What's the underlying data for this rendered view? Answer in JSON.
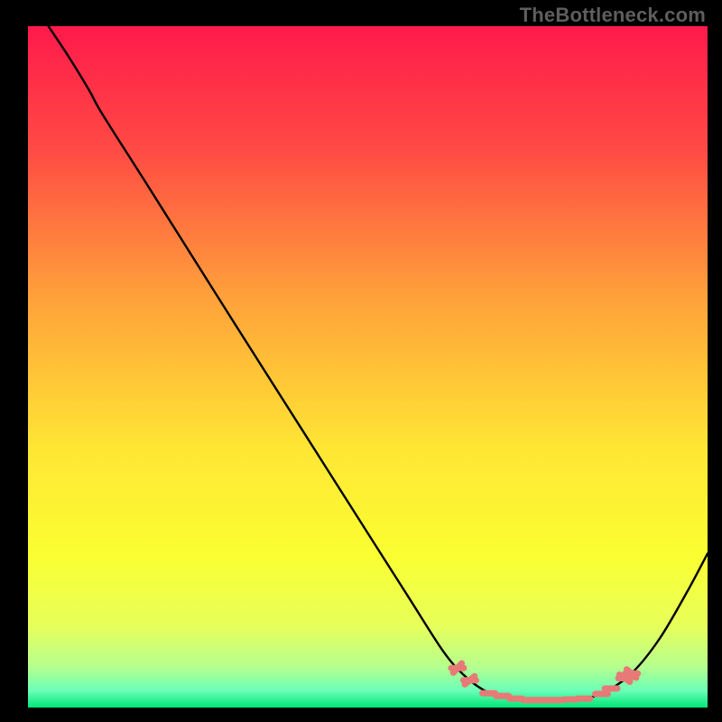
{
  "watermark": "TheBottleneck.com",
  "chart_data": {
    "type": "line",
    "title": "",
    "xlabel": "",
    "ylabel": "",
    "xlim": [
      0,
      100
    ],
    "ylim": [
      0,
      100
    ],
    "background_gradient": {
      "stops": [
        {
          "offset": 0.0,
          "color": "#ff1a4b"
        },
        {
          "offset": 0.18,
          "color": "#ff4a44"
        },
        {
          "offset": 0.4,
          "color": "#ffa23a"
        },
        {
          "offset": 0.62,
          "color": "#ffe634"
        },
        {
          "offset": 0.78,
          "color": "#faff32"
        },
        {
          "offset": 0.88,
          "color": "#e7ff5a"
        },
        {
          "offset": 0.94,
          "color": "#b6ff8e"
        },
        {
          "offset": 0.975,
          "color": "#6cffb8"
        },
        {
          "offset": 1.0,
          "color": "#00e676"
        }
      ]
    },
    "series": [
      {
        "name": "bottleneck-curve",
        "color": "#000000",
        "points": [
          {
            "x": 3.0,
            "y": 100.0
          },
          {
            "x": 6.0,
            "y": 95.5
          },
          {
            "x": 9.0,
            "y": 90.6
          },
          {
            "x": 11.0,
            "y": 87.0
          },
          {
            "x": 18.0,
            "y": 76.0
          },
          {
            "x": 30.0,
            "y": 57.0
          },
          {
            "x": 40.0,
            "y": 41.3
          },
          {
            "x": 50.0,
            "y": 25.6
          },
          {
            "x": 56.0,
            "y": 16.2
          },
          {
            "x": 61.0,
            "y": 8.4
          },
          {
            "x": 64.0,
            "y": 4.9
          },
          {
            "x": 67.0,
            "y": 2.6
          },
          {
            "x": 70.0,
            "y": 1.5
          },
          {
            "x": 74.0,
            "y": 1.1
          },
          {
            "x": 78.0,
            "y": 1.1
          },
          {
            "x": 82.0,
            "y": 1.4
          },
          {
            "x": 85.0,
            "y": 2.3
          },
          {
            "x": 89.0,
            "y": 5.2
          },
          {
            "x": 93.0,
            "y": 10.2
          },
          {
            "x": 97.0,
            "y": 17.0
          },
          {
            "x": 100.0,
            "y": 22.6
          }
        ]
      }
    ],
    "markers": {
      "name": "optimal-range",
      "color": "#e77a76",
      "size": 7,
      "points": [
        {
          "x": 63.2,
          "y": 5.8
        },
        {
          "x": 65.0,
          "y": 4.0
        },
        {
          "x": 67.8,
          "y": 2.1
        },
        {
          "x": 69.8,
          "y": 1.7
        },
        {
          "x": 71.8,
          "y": 1.3
        },
        {
          "x": 73.8,
          "y": 1.1
        },
        {
          "x": 75.8,
          "y": 1.1
        },
        {
          "x": 77.8,
          "y": 1.1
        },
        {
          "x": 79.8,
          "y": 1.2
        },
        {
          "x": 81.8,
          "y": 1.3
        },
        {
          "x": 84.4,
          "y": 2.0
        },
        {
          "x": 85.8,
          "y": 2.8
        },
        {
          "x": 87.8,
          "y": 4.3
        },
        {
          "x": 88.8,
          "y": 5.0
        }
      ]
    }
  }
}
